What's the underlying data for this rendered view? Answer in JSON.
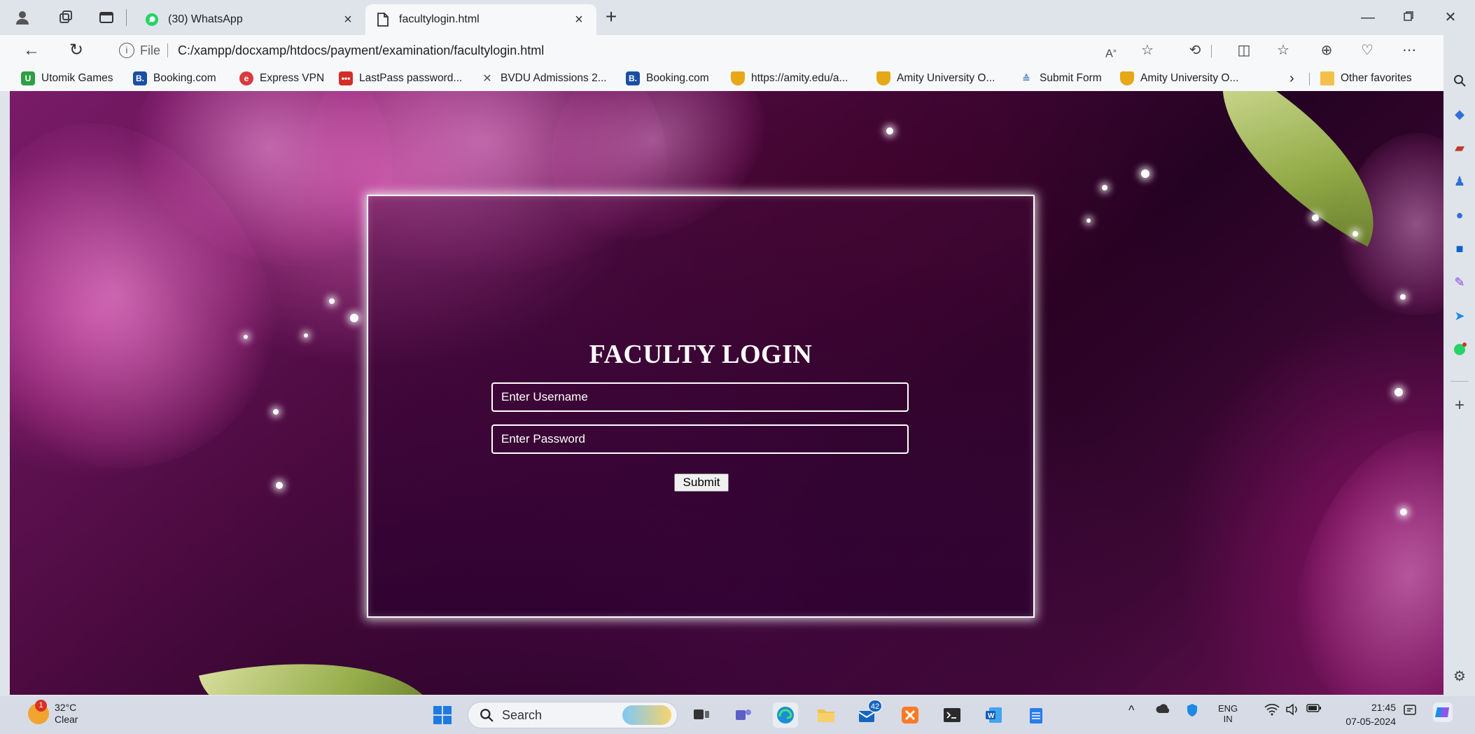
{
  "browser": {
    "tabs": [
      {
        "title": "(30) WhatsApp",
        "active": false
      },
      {
        "title": "facultylogin.html",
        "active": true
      }
    ],
    "address": {
      "scheme": "File",
      "url": "C:/xampp/docxamp/htdocs/payment/examination/facultylogin.html"
    },
    "bookmarks": [
      {
        "label": "Utomik Games",
        "icon": "utomik-icon",
        "color": "#2e9f45"
      },
      {
        "label": "Booking.com",
        "icon": "booking-icon",
        "color": "#1a4fa3"
      },
      {
        "label": "Express VPN",
        "icon": "expressvpn-icon",
        "color": "#da3940"
      },
      {
        "label": "LastPass password...",
        "icon": "lastpass-icon",
        "color": "#d32d27"
      },
      {
        "label": "BVDU Admissions 2...",
        "icon": "bvdu-icon",
        "color": "#555555"
      },
      {
        "label": "Booking.com",
        "icon": "booking-icon",
        "color": "#1a4fa3"
      },
      {
        "label": "https://amity.edu/a...",
        "icon": "amity-shield-icon",
        "color": "#e6a817"
      },
      {
        "label": "Amity University O...",
        "icon": "amity-shield-icon",
        "color": "#e6a817"
      },
      {
        "label": "Submit Form",
        "icon": "form-icon",
        "color": "#4a7fc1"
      },
      {
        "label": "Amity University O...",
        "icon": "amity-shield-icon",
        "color": "#e6a817"
      }
    ],
    "other_favorites": "Other favorites"
  },
  "page": {
    "title": "FACULTY LOGIN",
    "username_placeholder": "Enter Username",
    "password_placeholder": "Enter Password",
    "submit_label": "Submit"
  },
  "taskbar": {
    "weather_temp": "32°C",
    "weather_desc": "Clear",
    "weather_badge": "1",
    "search_label": "Search",
    "outlook_badge": "42",
    "lang_top": "ENG",
    "lang_bottom": "IN",
    "time": "21:45",
    "date": "07-05-2024"
  },
  "colors": {
    "chrome_bg": "#dfe3ea",
    "toolbar_bg": "#f7f8fa",
    "login_border": "#ffffff",
    "page_accent": "#7a1b68"
  }
}
